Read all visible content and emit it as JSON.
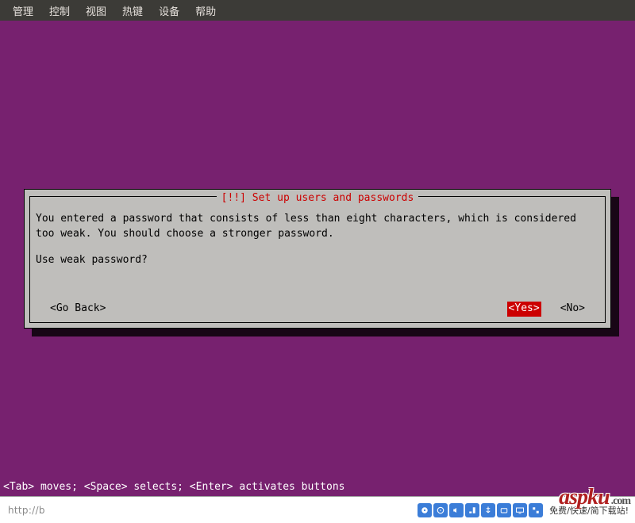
{
  "menubar": {
    "items": [
      "管理",
      "控制",
      "视图",
      "热键",
      "设备",
      "帮助"
    ]
  },
  "dialog": {
    "title": "[!!] Set up users and passwords",
    "message": "You entered a password that consists of less than eight characters, which is considered too weak. You should choose a stronger password.",
    "question": "Use weak password?",
    "go_back_label": "<Go Back>",
    "yes_label": "<Yes>",
    "no_label": "<No>"
  },
  "hint": "<Tab> moves; <Space> selects; <Enter> activates buttons",
  "taskbar": {
    "url": "http://b",
    "tray_text": "免费/快速/简下载站!"
  },
  "watermark": {
    "brand": "aspku",
    "suffix": ".com"
  }
}
